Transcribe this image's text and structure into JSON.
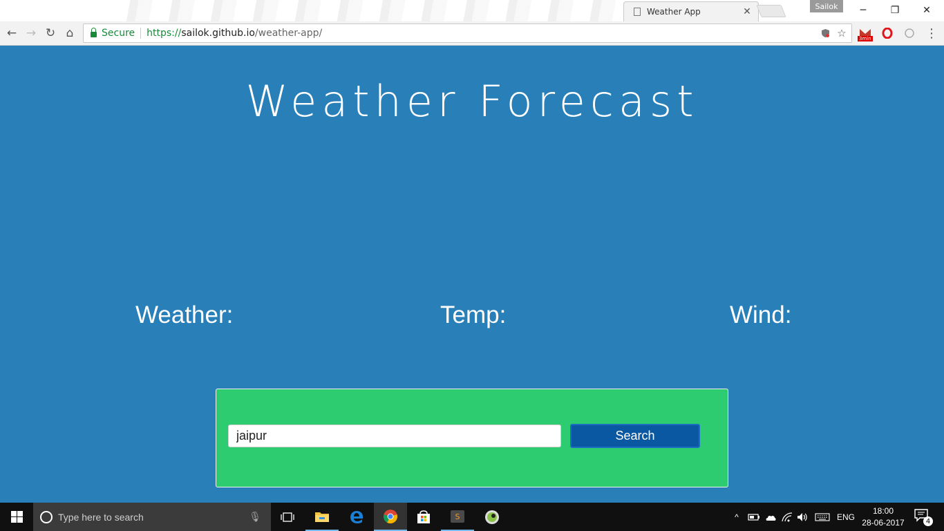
{
  "browser": {
    "tab_title": "Weather App",
    "tab_close": "✕",
    "profile_name": "Sailok",
    "window_controls": {
      "minimize": "─",
      "restore": "❐",
      "close": "✕"
    },
    "nav": {
      "back": "←",
      "forward": "→",
      "reload": "↻",
      "home": "⌂"
    },
    "secure_label": "Secure",
    "url": {
      "scheme": "https://",
      "host": "sailok.github.io",
      "path": "/weather-app/"
    },
    "extension_badge": "3min",
    "menu": "⋮"
  },
  "page": {
    "title": "Weather Forecast",
    "metrics": [
      {
        "label": "Weather:"
      },
      {
        "label": "Temp:"
      },
      {
        "label": "Wind:"
      }
    ],
    "search": {
      "value": "jaipur",
      "button_label": "Search"
    },
    "colors": {
      "background": "#2980b9",
      "panel": "#2ecc71",
      "button": "#0b58a2"
    }
  },
  "taskbar": {
    "search_placeholder": "Type here to search",
    "language": "ENG",
    "time": "18:00",
    "date": "28-06-2017",
    "notification_count": "4",
    "apps": [
      "task-view-icon",
      "file-explorer-icon",
      "edge-icon",
      "chrome-icon",
      "store-icon",
      "sublime-text-icon",
      "app-icon"
    ]
  }
}
